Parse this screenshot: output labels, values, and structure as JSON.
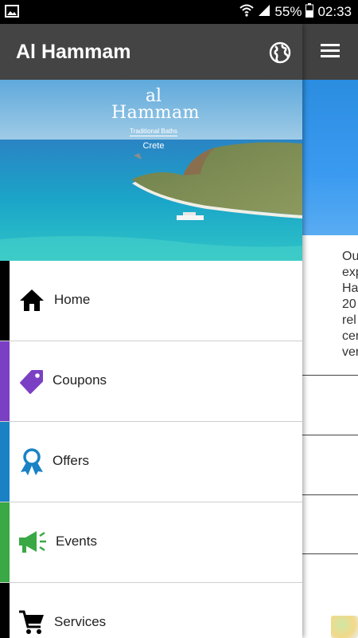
{
  "status_bar": {
    "battery_text": "55%",
    "time": "02:33"
  },
  "app": {
    "title": "Al Hammam",
    "logo": {
      "line1": "al",
      "line2": "Hammam",
      "subtitle": "Traditional Baths",
      "place": "Crete"
    }
  },
  "menu": {
    "items": [
      {
        "label": "Home",
        "icon": "home-icon",
        "color": "#000000"
      },
      {
        "label": "Coupons",
        "icon": "tag-icon",
        "color": "#7b3fc4"
      },
      {
        "label": "Offers",
        "icon": "ribbon-award-icon",
        "color": "#1a82c4"
      },
      {
        "label": "Events",
        "icon": "megaphone-icon",
        "color": "#3aa845"
      },
      {
        "label": "Services",
        "icon": "cart-icon",
        "color": "#000000"
      }
    ]
  },
  "background_page": {
    "text_lines": [
      "Ou",
      "exp",
      "Ha",
      "20",
      "rel",
      "cer",
      "ver"
    ]
  }
}
